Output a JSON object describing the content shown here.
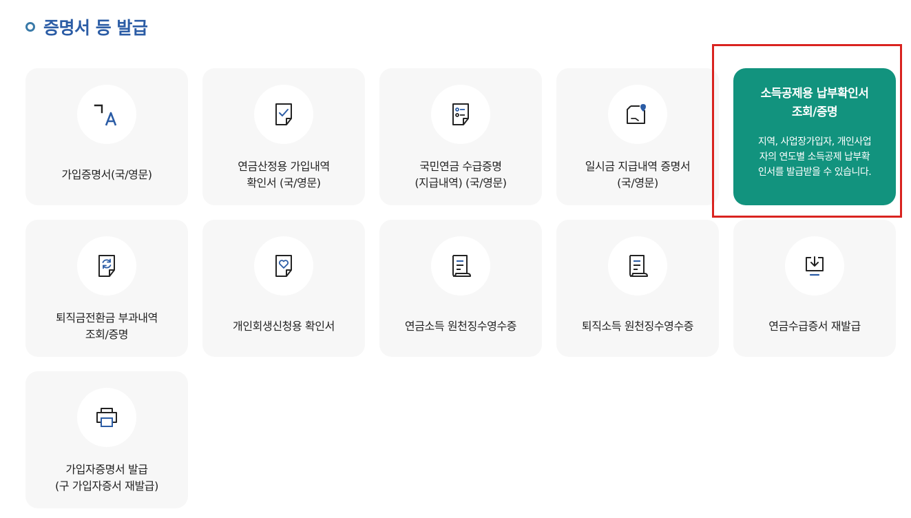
{
  "section": {
    "title": "증명서 등 발급"
  },
  "cards": [
    {
      "label": "가입증명서(국/영문)",
      "icon": "language-ka-icon"
    },
    {
      "label": "연금산정용 가입내역\n확인서 (국/영문)",
      "icon": "document-check-icon"
    },
    {
      "label": "국민연금 수급증명\n(지급내역) (국/영문)",
      "icon": "document-list-icon"
    },
    {
      "label": "일시금 지급내역 증명서\n(국/영문)",
      "icon": "document-pen-icon"
    },
    {
      "title": "소득공제용 납부확인서\n조회/증명",
      "description": "지역, 사업장가입자, 개인사업\n자의 연도별 소득공제 납부확\n인서를 발급받을 수 있습니다.",
      "highlight_color": "#12937e"
    },
    {
      "label": "퇴직금전환금 부과내역\n조회/증명",
      "icon": "document-refresh-icon"
    },
    {
      "label": "개인회생신청용 확인서",
      "icon": "document-heart-icon"
    },
    {
      "label": "연금소득 원천징수영수증",
      "icon": "receipt-icon"
    },
    {
      "label": "퇴직소득 원천징수영수증",
      "icon": "receipt-icon"
    },
    {
      "label": "연금수급증서 재발급",
      "icon": "download-tray-icon"
    },
    {
      "label": "가입자증명서 발급\n(구 가입자증서 재발급)",
      "icon": "printer-icon"
    }
  ],
  "colors": {
    "title": "#2b5ca5",
    "card_bg": "#f7f7f7",
    "highlight_bg": "#12937e",
    "highlight_frame": "#d9231f",
    "icon_stroke": "#222222",
    "icon_accent": "#2b5ca5"
  }
}
